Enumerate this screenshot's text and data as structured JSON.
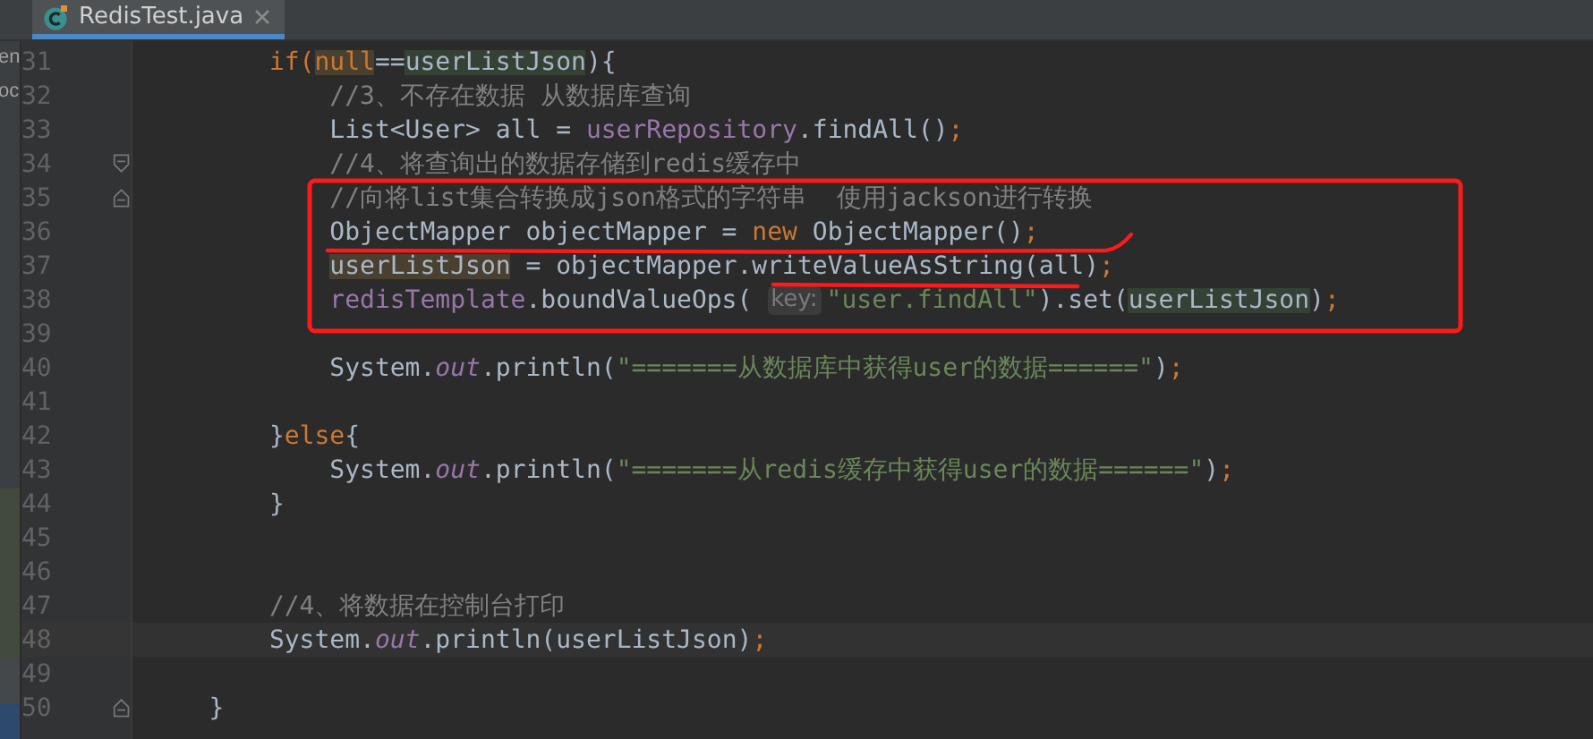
{
  "tab": {
    "label": "RedisTest.java",
    "selected": true
  },
  "side_panel": {
    "items": [
      "en",
      "oc"
    ]
  },
  "lines": [
    {
      "number": "31",
      "tokens": [
        {
          "text": "        if(",
          "kind": "keyword"
        },
        {
          "text": "null",
          "kind": "keyword",
          "write_highlight": true
        },
        {
          "text": "==",
          "kind": "plain"
        },
        {
          "text": "userListJson",
          "kind": "plain",
          "read_highlight": true
        },
        {
          "text": "){",
          "kind": "plain"
        }
      ]
    },
    {
      "number": "32",
      "tokens": [
        {
          "text": "            //3、不存在数据 从数据库查询",
          "kind": "comment"
        }
      ]
    },
    {
      "number": "33",
      "tokens": [
        {
          "text": "            List<User> all = ",
          "kind": "plain"
        },
        {
          "text": "userRepository",
          "kind": "field"
        },
        {
          "text": ".findAll()",
          "kind": "plain"
        },
        {
          "text": ";",
          "kind": "semicolon"
        }
      ]
    },
    {
      "number": "34",
      "fold": {
        "kind": "start"
      },
      "tokens": [
        {
          "text": "            //4、将查询出的数据存储到redis缓存中",
          "kind": "comment"
        }
      ]
    },
    {
      "number": "35",
      "fold": {
        "kind": "end"
      },
      "tokens": [
        {
          "text": "            //向将list集合转换成json格式的字符串  使用jackson进行转换",
          "kind": "comment"
        }
      ]
    },
    {
      "number": "36",
      "tokens": [
        {
          "text": "            ObjectMapper objectMapper = ",
          "kind": "plain"
        },
        {
          "text": "new",
          "kind": "keyword"
        },
        {
          "text": " ObjectMapper()",
          "kind": "plain"
        },
        {
          "text": ";",
          "kind": "semicolon"
        }
      ]
    },
    {
      "number": "37",
      "tokens": [
        {
          "text": "            userListJson",
          "kind": "plain",
          "write_highlight": true
        },
        {
          "text": " = objectMapper.writeValueAsString(all)",
          "kind": "plain"
        },
        {
          "text": ";",
          "kind": "semicolon"
        }
      ]
    },
    {
      "number": "38",
      "tokens": [
        {
          "text": "            redisTemplate",
          "kind": "field"
        },
        {
          "text": ".boundValueOps( ",
          "kind": "plain"
        },
        {
          "text": "key:",
          "kind": "hint"
        },
        {
          "text": "\"user.findAll\"",
          "kind": "string"
        },
        {
          "text": ").set(",
          "kind": "plain"
        },
        {
          "text": "userListJson",
          "kind": "plain",
          "read_highlight": true
        },
        {
          "text": ")",
          "kind": "plain"
        },
        {
          "text": ";",
          "kind": "semicolon"
        }
      ]
    },
    {
      "number": "39"
    },
    {
      "number": "40",
      "tokens": [
        {
          "text": "            System.",
          "kind": "plain"
        },
        {
          "text": "out",
          "kind": "static"
        },
        {
          "text": ".println(",
          "kind": "plain"
        },
        {
          "text": "\"=======从数据库中获得user的数据======\"",
          "kind": "string"
        },
        {
          "text": ")",
          "kind": "plain"
        },
        {
          "text": ";",
          "kind": "semicolon"
        }
      ]
    },
    {
      "number": "41"
    },
    {
      "number": "42",
      "tokens": [
        {
          "text": "        }",
          "kind": "plain"
        },
        {
          "text": "else",
          "kind": "keyword"
        },
        {
          "text": "{",
          "kind": "plain"
        }
      ]
    },
    {
      "number": "43",
      "tokens": [
        {
          "text": "            System.",
          "kind": "plain"
        },
        {
          "text": "out",
          "kind": "static"
        },
        {
          "text": ".println(",
          "kind": "plain"
        },
        {
          "text": "\"=======从redis缓存中获得user的数据======\"",
          "kind": "string"
        },
        {
          "text": ")",
          "kind": "plain"
        },
        {
          "text": ";",
          "kind": "semicolon"
        }
      ]
    },
    {
      "number": "44",
      "tokens": [
        {
          "text": "        }",
          "kind": "plain"
        }
      ]
    },
    {
      "number": "45"
    },
    {
      "number": "46"
    },
    {
      "number": "47",
      "tokens": [
        {
          "text": "        //4、将数据在控制台打印",
          "kind": "comment"
        }
      ]
    },
    {
      "number": "48",
      "current": true,
      "tokens": [
        {
          "text": "        System.",
          "kind": "plain"
        },
        {
          "text": "out",
          "kind": "static"
        },
        {
          "text": ".println(userListJson)",
          "kind": "plain"
        },
        {
          "text": ";",
          "kind": "semicolon"
        }
      ]
    },
    {
      "number": "49"
    },
    {
      "number": "50",
      "fold": {
        "kind": "end"
      },
      "tokens": [
        {
          "text": "    }",
          "kind": "plain"
        }
      ]
    }
  ],
  "annotations": [
    {
      "kind": "box"
    },
    {
      "kind": "underline"
    },
    {
      "kind": "underline"
    }
  ]
}
